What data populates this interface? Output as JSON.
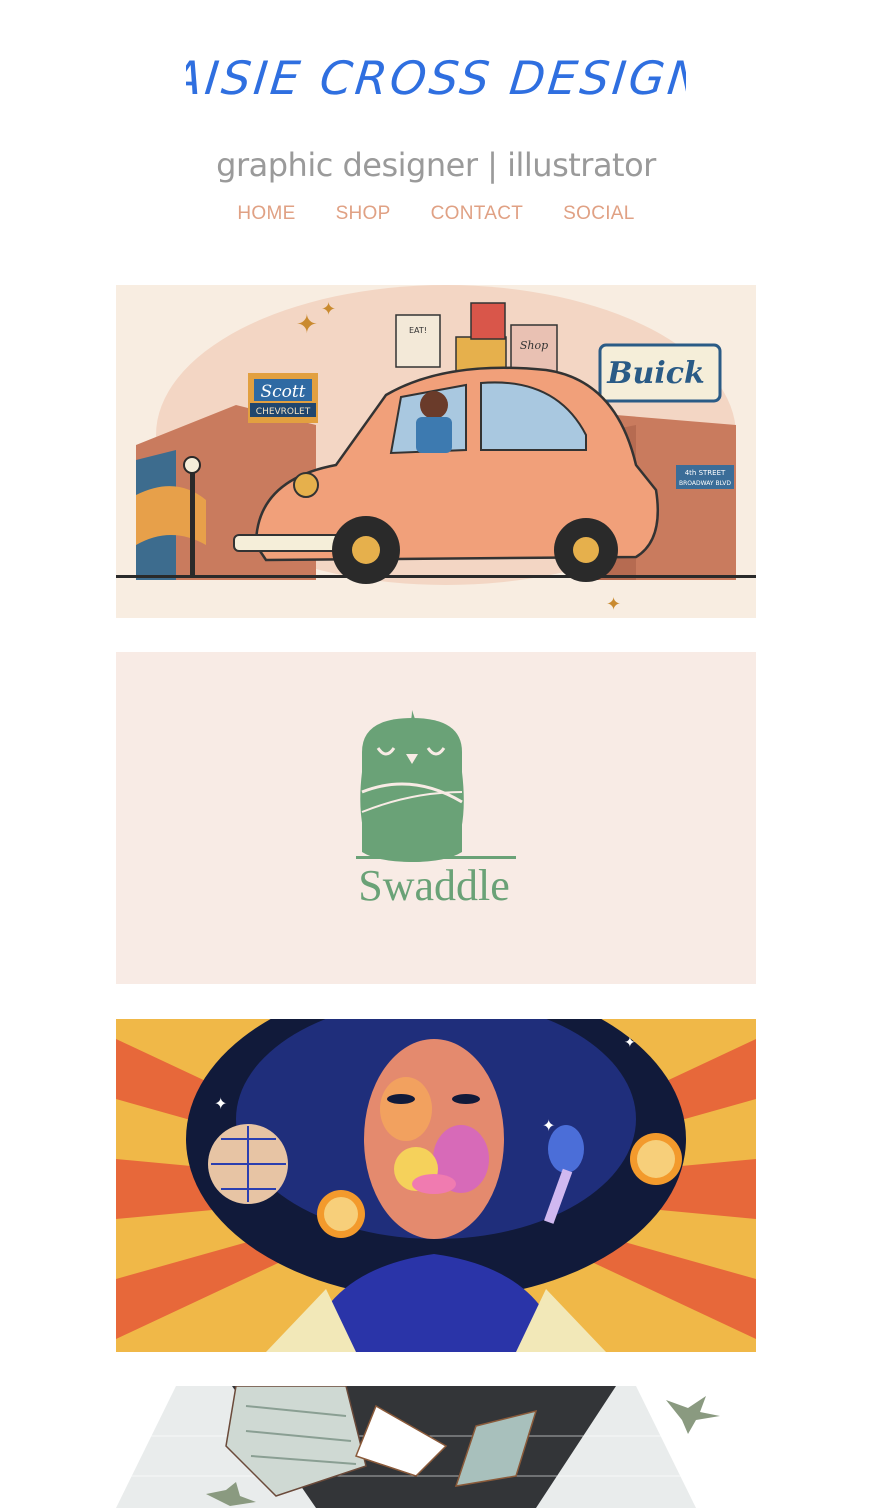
{
  "header": {
    "logo_text": "MAISIE CROSS DESIGNS",
    "tagline": "graphic designer | illustrator"
  },
  "nav": {
    "items": [
      "HOME",
      "SHOP",
      "CONTACT",
      "SOCIAL"
    ]
  },
  "gallery": {
    "card1": {
      "signs": {
        "scott": "Scott",
        "chevrolet": "CHEVROLET",
        "buick": "Buick",
        "eat": "EAT!",
        "shop": "Shop",
        "street": "4th STREET",
        "broadway": "BROADWAY BLVD"
      }
    },
    "card2": {
      "brand": "Swaddle"
    }
  },
  "colors": {
    "logo_blue": "#2f6fe0",
    "nav_salmon": "#e0a184",
    "tagline_gray": "#9a9a9a",
    "swaddle_bg": "#f8ebe5",
    "swaddle_green": "#6aa277"
  }
}
